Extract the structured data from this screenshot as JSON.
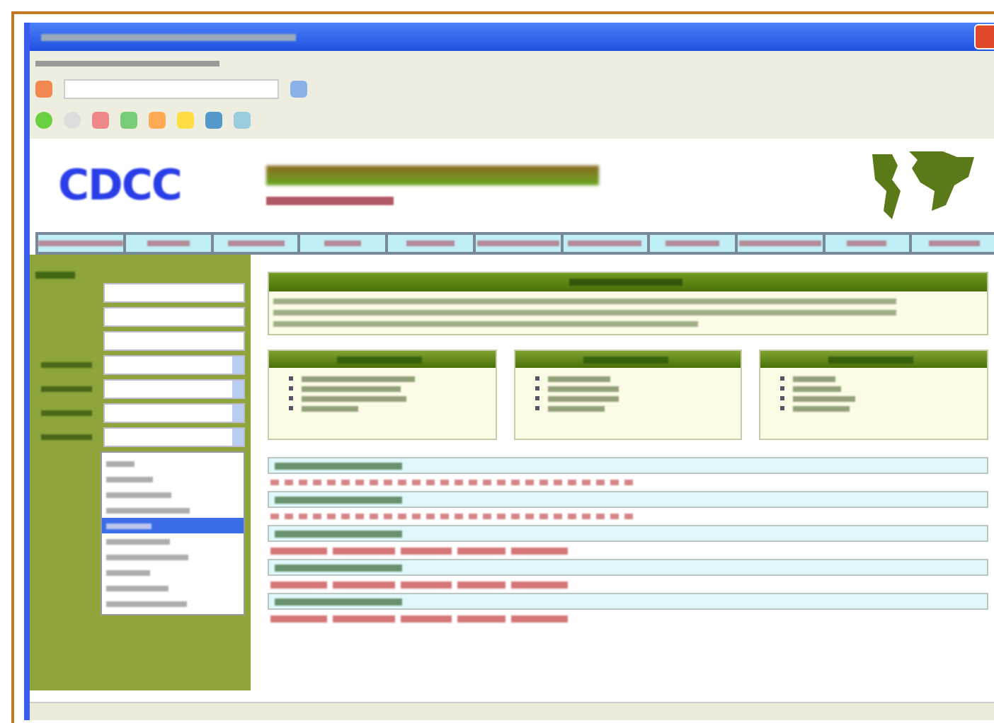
{
  "header": {
    "logo": "CDCC"
  },
  "sidebar": {
    "dropdown_options": [
      {
        "selected": false
      },
      {
        "selected": false
      },
      {
        "selected": false
      },
      {
        "selected": false
      },
      {
        "selected": true
      },
      {
        "selected": false
      },
      {
        "selected": false
      },
      {
        "selected": false
      },
      {
        "selected": false
      },
      {
        "selected": false
      }
    ]
  },
  "sections": [
    {
      "kind": "letters"
    },
    {
      "kind": "letters"
    },
    {
      "kind": "links"
    },
    {
      "kind": "links"
    },
    {
      "kind": "links"
    }
  ]
}
